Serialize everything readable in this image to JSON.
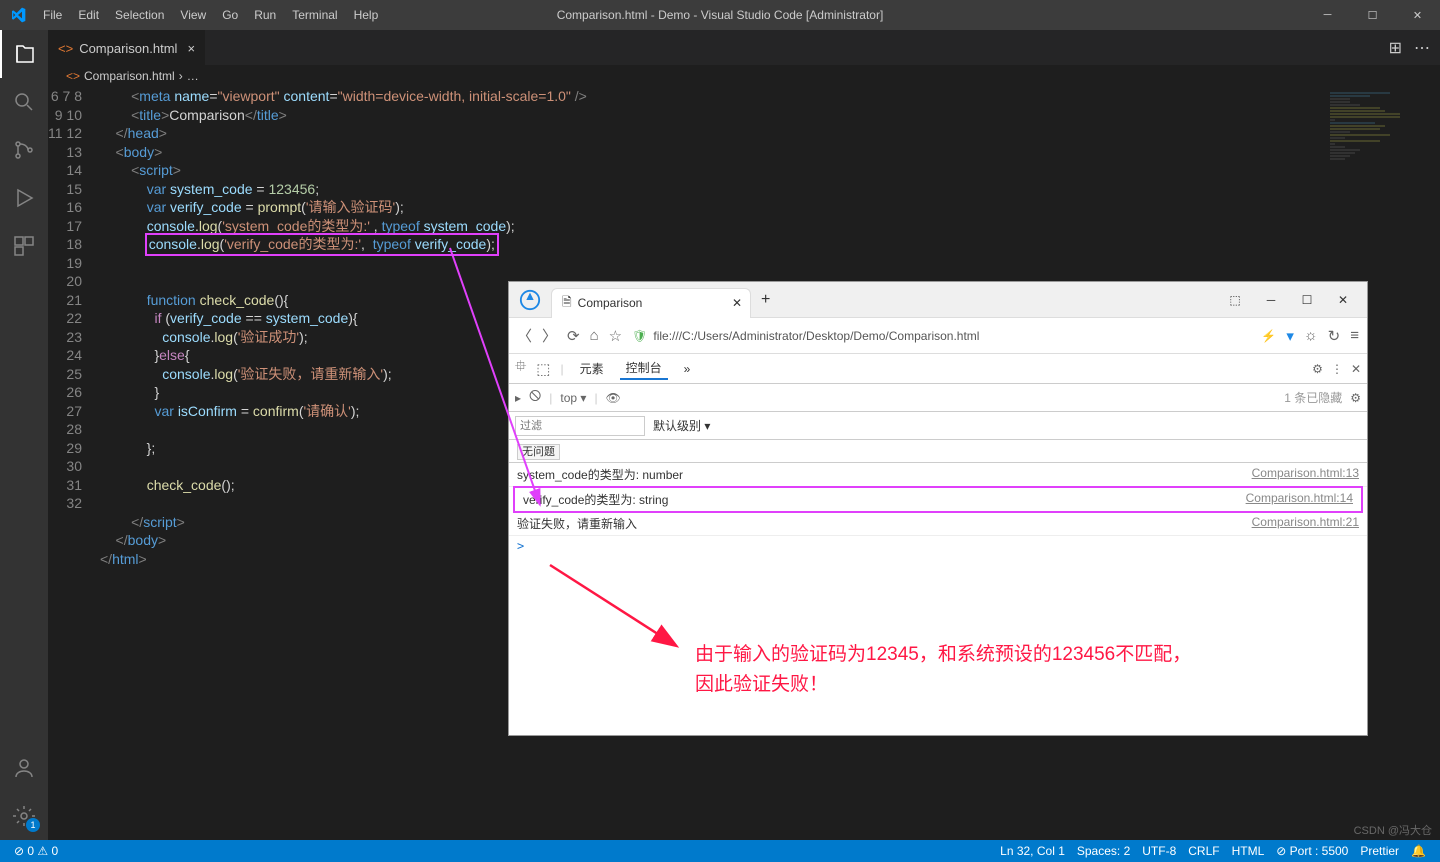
{
  "titlebar": {
    "menus": [
      "File",
      "Edit",
      "Selection",
      "View",
      "Go",
      "Run",
      "Terminal",
      "Help"
    ],
    "title": "Comparison.html - Demo - Visual Studio Code [Administrator]"
  },
  "tab": {
    "filename": "Comparison.html",
    "close": "×"
  },
  "tabs_right_icons": [
    "⊞",
    "⋯"
  ],
  "breadcrumb": {
    "file": "Comparison.html",
    "sep": "›",
    "ell": "…"
  },
  "gutter_start": 6,
  "gutter_end": 32,
  "code": {
    "l6": {
      "p1": "        <",
      "tag": "meta",
      "p2": " ",
      "a1": "name",
      "p3": "=",
      "v1": "\"viewport\"",
      "p4": " ",
      "a2": "content",
      "p5": "=",
      "v2": "\"width=device-width, initial-scale=1.0\"",
      "p6": " />"
    },
    "l7": {
      "p1": "        <",
      "tag": "title",
      "p2": ">",
      "txt": "Comparison",
      "p3": "</",
      "tag2": "title",
      "p4": ">"
    },
    "l8": {
      "p1": "    </",
      "tag": "head",
      "p2": ">"
    },
    "l9": {
      "p1": "    <",
      "tag": "body",
      "p2": ">"
    },
    "l10": {
      "p1": "        <",
      "tag": "script",
      "p2": ">"
    },
    "l11": {
      "p1": "            ",
      "kw": "var",
      "sp": " ",
      "vr": "system_code",
      "eq": " = ",
      "num": "123456",
      "sc": ";"
    },
    "l12": {
      "p1": "            ",
      "kw": "var",
      "sp": " ",
      "vr": "verify_code",
      "eq": " = ",
      "fn": "prompt",
      "op": "(",
      "str": "'请输入验证码'",
      "cp": ");"
    },
    "l13": {
      "p1": "            ",
      "obj": "console",
      "dot": ".",
      "fn": "log",
      "op": "(",
      "str": "'system_code的类型为:'",
      "cm": " , ",
      "kw": "typeof",
      "sp": " ",
      "vr": "system_code",
      "cp": ");"
    },
    "l14": {
      "p1": "            ",
      "obj": "console",
      "dot": ".",
      "fn": "log",
      "op": "(",
      "str": "'verify_code的类型为:'",
      "cm": ",  ",
      "kw": "typeof",
      "sp": " ",
      "vr": "verify_code",
      "cp": ");"
    },
    "l17": {
      "p1": "            ",
      "kw": "function",
      "sp": " ",
      "fn": "check_code",
      "pr": "(){"
    },
    "l18": {
      "p1": "              ",
      "kw": "if",
      "op": " (",
      "v1": "verify_code",
      "eq": " == ",
      "v2": "system_code",
      "cp": "){"
    },
    "l19": {
      "p1": "                ",
      "obj": "console",
      "dot": ".",
      "fn": "log",
      "op": "(",
      "str": "'验证成功'",
      "cp": ");"
    },
    "l20": {
      "p1": "              }",
      "kw": "else",
      "op": "{"
    },
    "l21": {
      "p1": "                ",
      "obj": "console",
      "dot": ".",
      "fn": "log",
      "op": "(",
      "str": "'验证失败，请重新输入'",
      "cp": ");"
    },
    "l22": {
      "p1": "              }"
    },
    "l23": {
      "p1": "              ",
      "kw": "var",
      "sp": " ",
      "vr": "isConfirm",
      "eq": " = ",
      "fn": "confirm",
      "op": "(",
      "str": "'请确认'",
      "cp": ");"
    },
    "l25": {
      "p1": "            };"
    },
    "l27": {
      "p1": "            ",
      "fn": "check_code",
      "op": "();"
    },
    "l29": {
      "p1": "        </",
      "tag": "script",
      "p2": ">"
    },
    "l30": {
      "p1": "    </",
      "tag": "body",
      "p2": ">"
    },
    "l31": {
      "p1": "</",
      "tag": "html",
      "p2": ">"
    }
  },
  "statusbar": {
    "left": [
      "⊘ 0 ⚠ 0"
    ],
    "right": [
      "Ln 32, Col 1",
      "Spaces: 2",
      "UTF-8",
      "CRLF",
      "HTML",
      "⊘ Port : 5500",
      "Prettier",
      "🔔"
    ]
  },
  "activity_badge": "1",
  "browser": {
    "tab_title": "Comparison",
    "url": "file:///C:/Users/Administrator/Desktop/Demo/Comparison.html",
    "dt_tabs": [
      "元素",
      "控制台"
    ],
    "dt_more": "»",
    "top_label": "top ▾",
    "hidden_msg": "1 条已隐藏",
    "filter_ph": "过滤",
    "level_label": "默认级别 ▾",
    "no_issues": "无问题",
    "rows": [
      {
        "msg": "system_code的类型为: number",
        "src": "Comparison.html:13"
      },
      {
        "msg": "verify_code的类型为: string",
        "src": "Comparison.html:14"
      },
      {
        "msg": "验证失败，请重新输入",
        "src": "Comparison.html:21"
      }
    ],
    "prompt": ">"
  },
  "annotation_text": {
    "l1": "由于输入的验证码为12345，和系统预设的123456不匹配，",
    "l2": "因此验证失败！"
  },
  "watermark": "CSDN @冯大仓"
}
